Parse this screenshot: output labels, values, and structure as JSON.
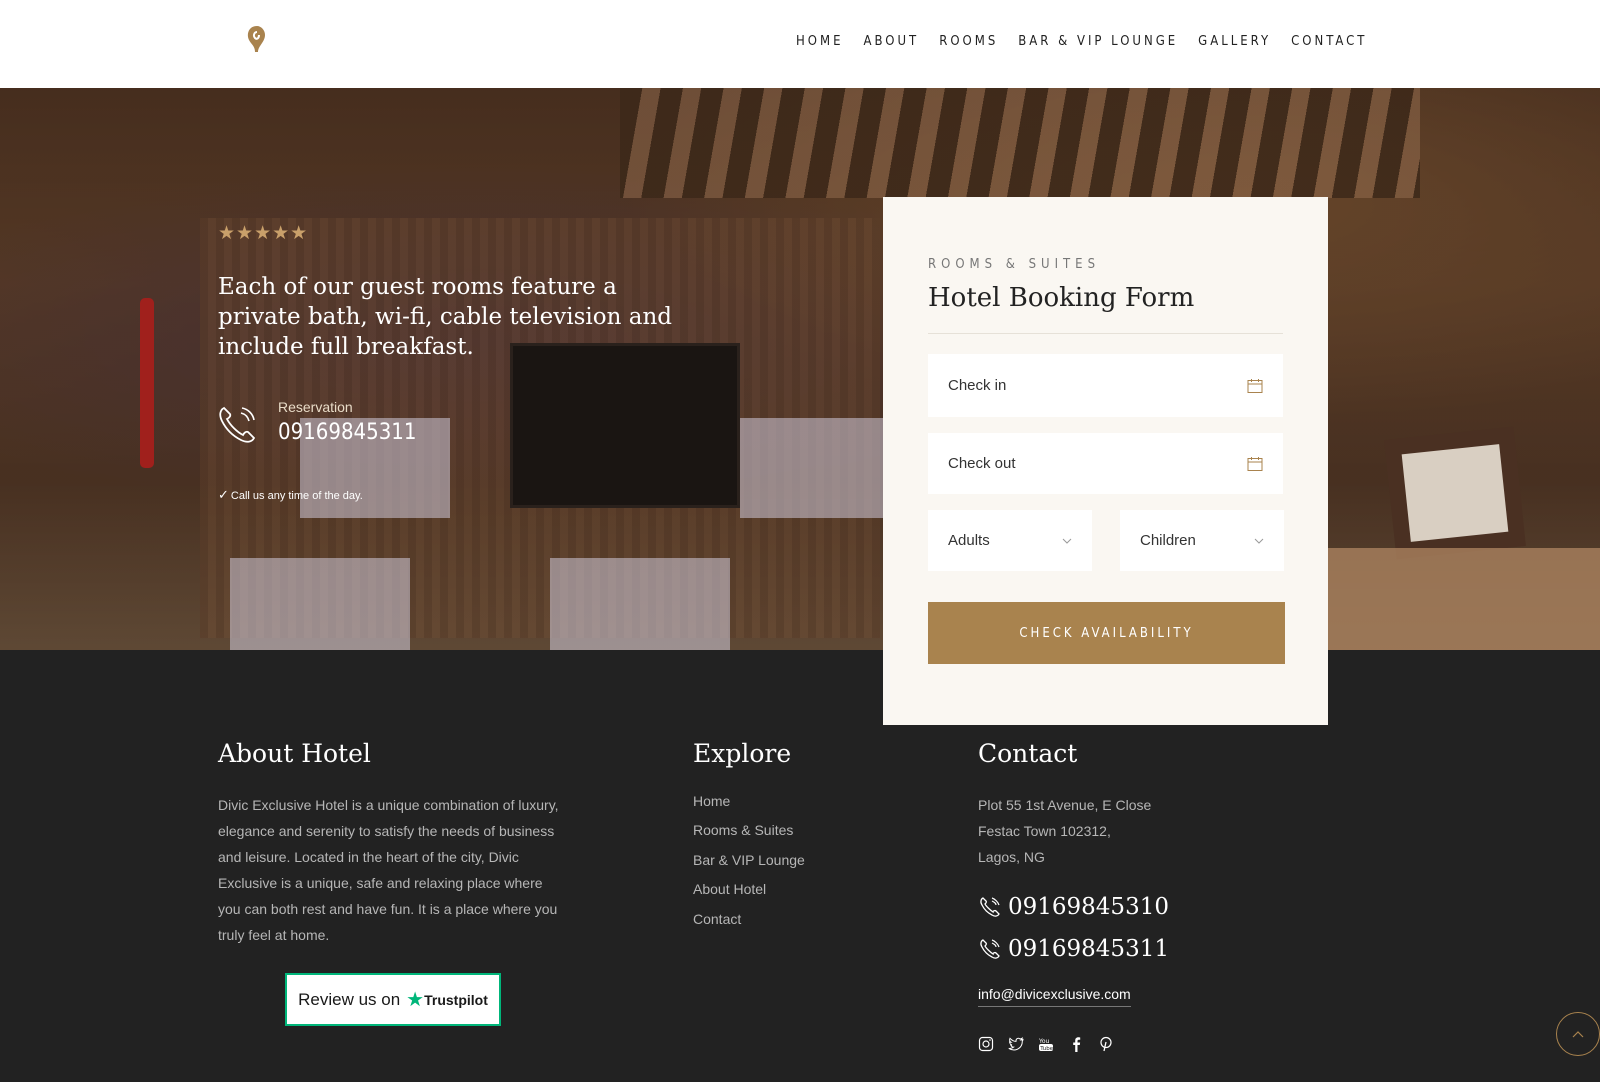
{
  "nav": {
    "items": [
      "HOME",
      "ABOUT",
      "ROOMS",
      "BAR & VIP LOUNGE",
      "GALLERY",
      "CONTACT"
    ]
  },
  "hero": {
    "stars": "★★★★★",
    "text": "Each of our guest rooms feature a private bath, wi-fi, cable television and include full breakfast.",
    "reservation_label": "Reservation",
    "reservation_phone": "09169845311",
    "call_note": "Call us any time of the day."
  },
  "booking": {
    "overline": "ROOMS & SUITES",
    "title": "Hotel Booking Form",
    "checkin_placeholder": "Check in",
    "checkout_placeholder": "Check out",
    "adults": "Adults",
    "children": "Children",
    "button": "CHECK AVAILABILITY"
  },
  "footer": {
    "about_title": "About Hotel",
    "about_text": "Divic Exclusive Hotel is a unique combination of luxury, elegance and serenity to satisfy the needs of business and leisure. Located in the heart of the city, Divic Exclusive is a unique, safe and relaxing place where you can both rest and have fun. It is a place where you truly feel at home.",
    "trustpilot": {
      "review": "Review us on",
      "star": "★",
      "name": "Trustpilot"
    },
    "explore_title": "Explore",
    "explore_links": [
      "Home",
      "Rooms & Suites",
      "Bar & VIP Lounge",
      "About Hotel",
      "Contact"
    ],
    "contact_title": "Contact",
    "address": [
      "Plot 55 1st Avenue, E Close",
      "Festac Town 102312,",
      "Lagos, NG"
    ],
    "phones": [
      "09169845310",
      "09169845311"
    ],
    "email": "info@divicexclusive.com",
    "socials": [
      "instagram-icon",
      "twitter-icon",
      "youtube-icon",
      "facebook-icon",
      "pinterest-icon"
    ]
  },
  "colors": {
    "accent": "#a9834e",
    "dark": "#222222",
    "cream": "#faf7f2",
    "star": "#c9a06a"
  }
}
